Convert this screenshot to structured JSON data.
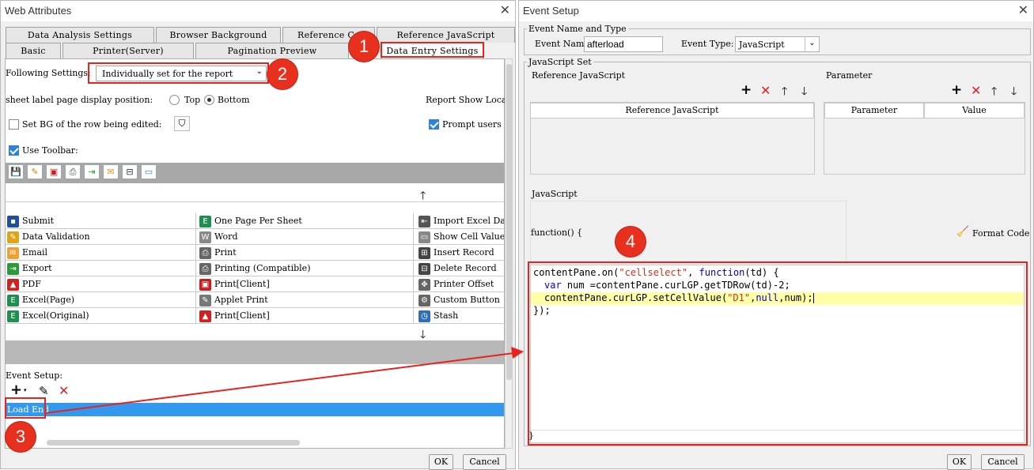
{
  "left_dialog": {
    "title": "Web Attributes",
    "tabs_row1": [
      "Data Analysis Settings",
      "Browser Background",
      "Reference Ca",
      "Reference JavaScript"
    ],
    "tabs_row2": [
      "Basic",
      "Printer(Server)",
      "Pagination Preview",
      "Data Entry Settings"
    ],
    "following_label": "Following Settings:",
    "following_value": "Individually set for the report",
    "sheet_label": "sheet label page display position:",
    "radio_top": "Top",
    "radio_bottom": "Bottom",
    "report_show": "Report Show Locat",
    "set_bg": "Set BG of the row being edited:",
    "prompt_users": "Prompt users",
    "use_toolbar": "Use Toolbar:",
    "buttons_col1": [
      "Submit",
      "Data Validation",
      "Email",
      "Export",
      "PDF",
      "Excel(Page)",
      "Excel(Original)"
    ],
    "buttons_col2": [
      "One Page Per Sheet",
      "Word",
      "Print",
      "Printing (Compatible)",
      "Print[Client]",
      "Applet Print",
      "Print[Client]"
    ],
    "buttons_col3": [
      "Import Excel Da",
      "Show Cell Value",
      "Insert Record",
      "Delete Record",
      "Printer Offset",
      "Custom Button",
      "Stash"
    ],
    "event_setup": "Event Setup:",
    "event_item": "Load End",
    "ok": "OK",
    "cancel": "Cancel"
  },
  "right_dialog": {
    "title": "Event Setup",
    "group_name_type": "Event Name and Type",
    "event_name_label": "Event Name:",
    "event_name_value": "afterload",
    "event_type_label": "Event Type:",
    "event_type_value": "JavaScript",
    "group_js_set": "JavaScript Set",
    "ref_js_label": "Reference JavaScript",
    "ref_js_column": "Reference JavaScript",
    "parameter_label": "Parameter",
    "param_col": "Parameter",
    "value_col": "Value",
    "javascript_label": "JavaScript",
    "function_header": "function() {",
    "format_code": "Format Code",
    "code_line1_a": "contentPane.on(",
    "code_line1_str": "\"cellselect\"",
    "code_line1_b": ", ",
    "code_line1_kw": "function",
    "code_line1_c": "(td) {",
    "code_line2_kw": "var",
    "code_line2_rest": " num =contentPane.curLGP.getTDRow(td)-2;",
    "code_line3_a": "contentPane.curLGP.setCellValue(",
    "code_line3_str": "\"D1\"",
    "code_line3_b": ",",
    "code_line3_kw1": "null",
    "code_line3_c": ",num);",
    "code_line4": "});",
    "closing_brace": "}",
    "ok": "OK",
    "cancel": "Cancel"
  },
  "badges": [
    "1",
    "2",
    "3",
    "4"
  ],
  "colors": {
    "annotation_red": "#e8231c",
    "selection_blue": "#3399ee",
    "code_highlight": "#ffffa8",
    "keyword_blue": "#0000c8",
    "string_red": "#c8321e"
  }
}
